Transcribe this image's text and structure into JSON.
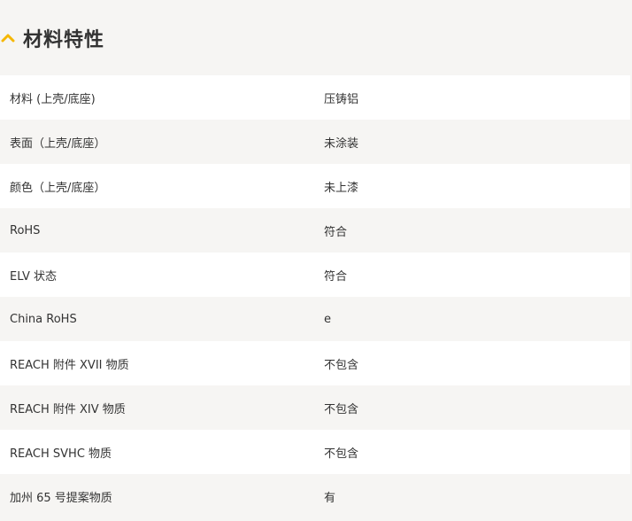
{
  "section": {
    "title": "材料特性",
    "toggle_icon": "chevron-up-icon",
    "accent_color": "#f5b700"
  },
  "rows": [
    {
      "label": "材料 (上壳/底座)",
      "value": "压铸铝"
    },
    {
      "label": "表面（上壳/底座）",
      "value": "未涂装"
    },
    {
      "label": "颜色（上壳/底座）",
      "value": "未上漆"
    },
    {
      "label": "RoHS",
      "value": "符合"
    },
    {
      "label": "ELV 状态",
      "value": "符合"
    },
    {
      "label": "China RoHS",
      "value": "e"
    },
    {
      "label": "REACH 附件 XVII 物质",
      "value": "不包含"
    },
    {
      "label": "REACH 附件 XIV 物质",
      "value": "不包含"
    },
    {
      "label": "REACH SVHC 物质",
      "value": "不包含"
    },
    {
      "label": "加州 65 号提案物质",
      "value": "有"
    }
  ]
}
